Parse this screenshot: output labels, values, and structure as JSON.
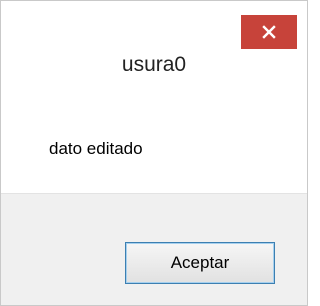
{
  "window": {
    "title": "usura0",
    "close_icon": "close-icon"
  },
  "message": {
    "text": "dato editado"
  },
  "footer": {
    "ok_label": "Aceptar"
  },
  "colors": {
    "close_button": "#c7433a",
    "footer_background": "#f0f0f0",
    "button_border": "#3c7fb1"
  }
}
